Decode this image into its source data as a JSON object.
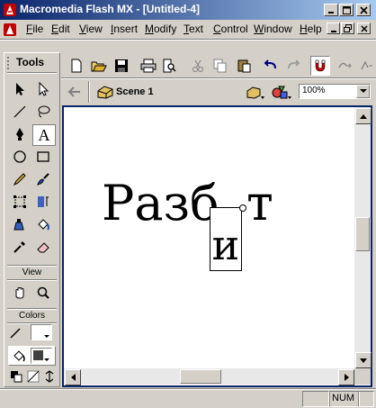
{
  "window": {
    "title": "Macromedia Flash MX - [Untitled-4]",
    "controls": {
      "minimize": "_",
      "maximize": "□",
      "close": "×"
    }
  },
  "menu": [
    {
      "label": "File",
      "u": "F",
      "rest": "ile"
    },
    {
      "label": "Edit",
      "u": "E",
      "rest": "dit"
    },
    {
      "label": "View",
      "u": "V",
      "rest": "iew"
    },
    {
      "label": "Insert",
      "u": "I",
      "rest": "nsert"
    },
    {
      "label": "Modify",
      "u": "M",
      "rest": "odify"
    },
    {
      "label": "Text",
      "u": "T",
      "rest": "ext"
    },
    {
      "label": "Control",
      "u": "C",
      "rest": "ontrol"
    },
    {
      "label": "Window",
      "u": "W",
      "rest": "indow"
    },
    {
      "label": "Help",
      "u": "H",
      "rest": "elp"
    }
  ],
  "tools": {
    "header": "Tools",
    "view_label": "View",
    "colors_label": "Colors",
    "selected_tool": "text-tool"
  },
  "timeline": {
    "scene_label": "Scene 1",
    "zoom": "100%"
  },
  "stage": {
    "text_main": "Разб",
    "text_tail": "т",
    "text_edit": "и"
  },
  "status": {
    "num": "NUM"
  },
  "colors": {
    "titlebar_start": "#0a246a",
    "titlebar_end": "#a6caf0",
    "chrome": "#d4d0c8",
    "stage": "#ffffff",
    "active_frame": "#0a246a"
  }
}
